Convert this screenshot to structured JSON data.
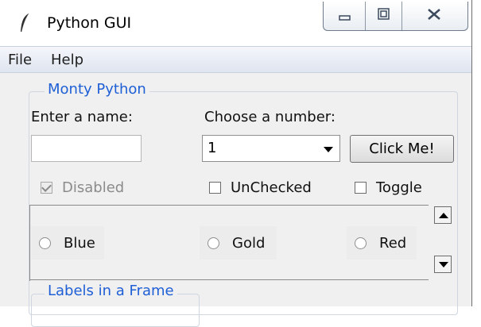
{
  "window": {
    "title": "Python GUI",
    "controls": [
      "minimize-icon",
      "maximize-icon",
      "close-icon"
    ]
  },
  "menu": {
    "items": [
      "File",
      "Help"
    ]
  },
  "frame": {
    "label": "Monty Python",
    "name_label": "Enter a name:",
    "name_value": "",
    "number_label": "Choose a number:",
    "number_value": "1",
    "button_label": "Click Me!"
  },
  "checks": [
    {
      "label": "Disabled",
      "checked": true,
      "disabled": true
    },
    {
      "label": "UnChecked",
      "checked": false,
      "disabled": false
    },
    {
      "label": "Toggle",
      "checked": false,
      "disabled": false
    }
  ],
  "radios": [
    "Blue",
    "Gold",
    "Red"
  ],
  "frame2": {
    "label": "Labels in a Frame"
  },
  "colors": {
    "frame_label": "#1f5fd6",
    "window_bg": "#f0f0f0"
  }
}
